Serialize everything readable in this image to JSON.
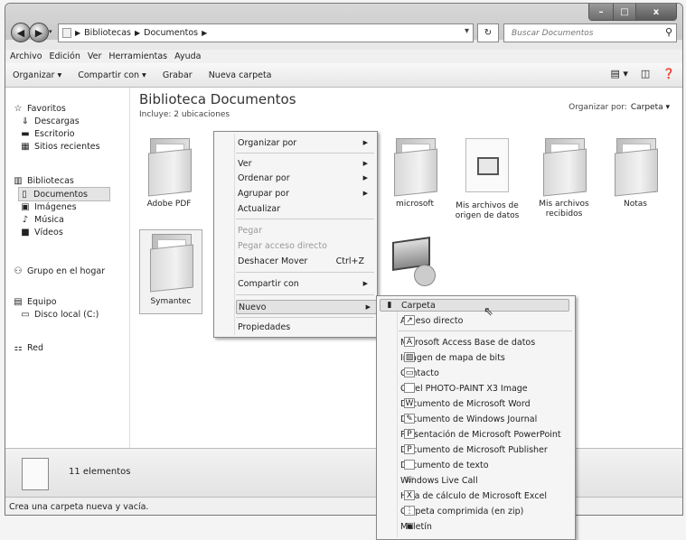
{
  "window": {
    "address": [
      "Bibliotecas",
      "Documentos"
    ],
    "search_placeholder": "Buscar Documentos"
  },
  "menubar": [
    "Archivo",
    "Edición",
    "Ver",
    "Herramientas",
    "Ayuda"
  ],
  "toolbar": {
    "organize": "Organizar ▾",
    "share": "Compartir con ▾",
    "burn": "Grabar",
    "new_folder": "Nueva carpeta"
  },
  "nav": {
    "favorites": "Favoritos",
    "downloads": "Descargas",
    "desktop": "Escritorio",
    "recent": "Sitios recientes",
    "libraries": "Bibliotecas",
    "documents": "Documentos",
    "images": "Imágenes",
    "music": "Música",
    "videos": "Vídeos",
    "homegroup": "Grupo en el hogar",
    "computer": "Equipo",
    "local_disk": "Disco local (C:)",
    "network": "Red"
  },
  "content": {
    "title": "Biblioteca Documentos",
    "subtitle": "Incluye: 2 ubicaciones",
    "arrange_label": "Organizar por:",
    "arrange_value": "Carpeta ▾",
    "items": {
      "adobe": "Adobe PDF",
      "microsoft": "microsoft",
      "data_sources": "Mis archivos de origen de datos",
      "received": "Mis archivos recibidos",
      "notes": "Notas",
      "symantec": "Symantec"
    }
  },
  "status": {
    "count": "11 elementos",
    "hint": "Crea una carpeta nueva y vacía."
  },
  "context_menu": {
    "arrange": "Organizar por",
    "view": "Ver",
    "sort": "Ordenar por",
    "group": "Agrupar por",
    "refresh": "Actualizar",
    "paste": "Pegar",
    "paste_shortcut": "Pegar acceso directo",
    "undo_move": "Deshacer Mover",
    "undo_shortcut": "Ctrl+Z",
    "share": "Compartir con",
    "new": "Nuevo",
    "properties": "Propiedades"
  },
  "submenu": {
    "folder": "Carpeta",
    "shortcut": "Acceso directo",
    "access": "Microsoft Access Base de datos",
    "bitmap": "Imagen de mapa de bits",
    "contact": "Contacto",
    "corel": "Corel PHOTO-PAINT X3 Image",
    "word": "Documento de Microsoft Word",
    "journal": "Documento de Windows Journal",
    "powerpoint": "Presentación de Microsoft PowerPoint",
    "publisher": "Documento de Microsoft Publisher",
    "text": "Documento de texto",
    "livecall": "Windows Live Call",
    "excel": "Hoja de cálculo de Microsoft Excel",
    "zip": "Carpeta comprimida (en zip)",
    "briefcase": "Maletín"
  }
}
